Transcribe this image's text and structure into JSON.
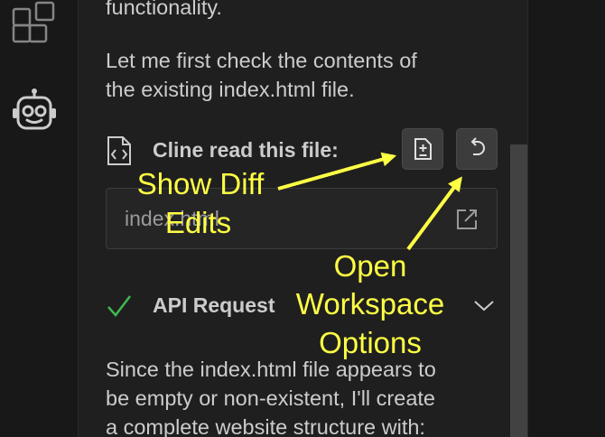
{
  "sidebar": {
    "icons": [
      "extensions-icon",
      "robot-icon"
    ]
  },
  "chat": {
    "intro_line": "functionality.",
    "check_lines": [
      "Let me first check the contents of",
      "the existing index.html file."
    ],
    "file_read": {
      "label": "Cline read this file:",
      "filename": "index.html",
      "actions": [
        "add-file-icon",
        "undo-icon"
      ]
    },
    "api_request": {
      "label": "API Request"
    },
    "response_lines": [
      "Since the index.html file appears to",
      "be empty or non-existent, I'll create",
      "a complete website structure with:"
    ]
  },
  "annotations": {
    "show_diff": [
      "Show Diff",
      "Edits"
    ],
    "open_workspace": [
      "Open",
      "Workspace",
      "Options"
    ]
  },
  "colors": {
    "annotation": "#ffff44",
    "check": "#3fb950",
    "text": "#cccccc",
    "panel_bg": "#1f1f1f"
  }
}
